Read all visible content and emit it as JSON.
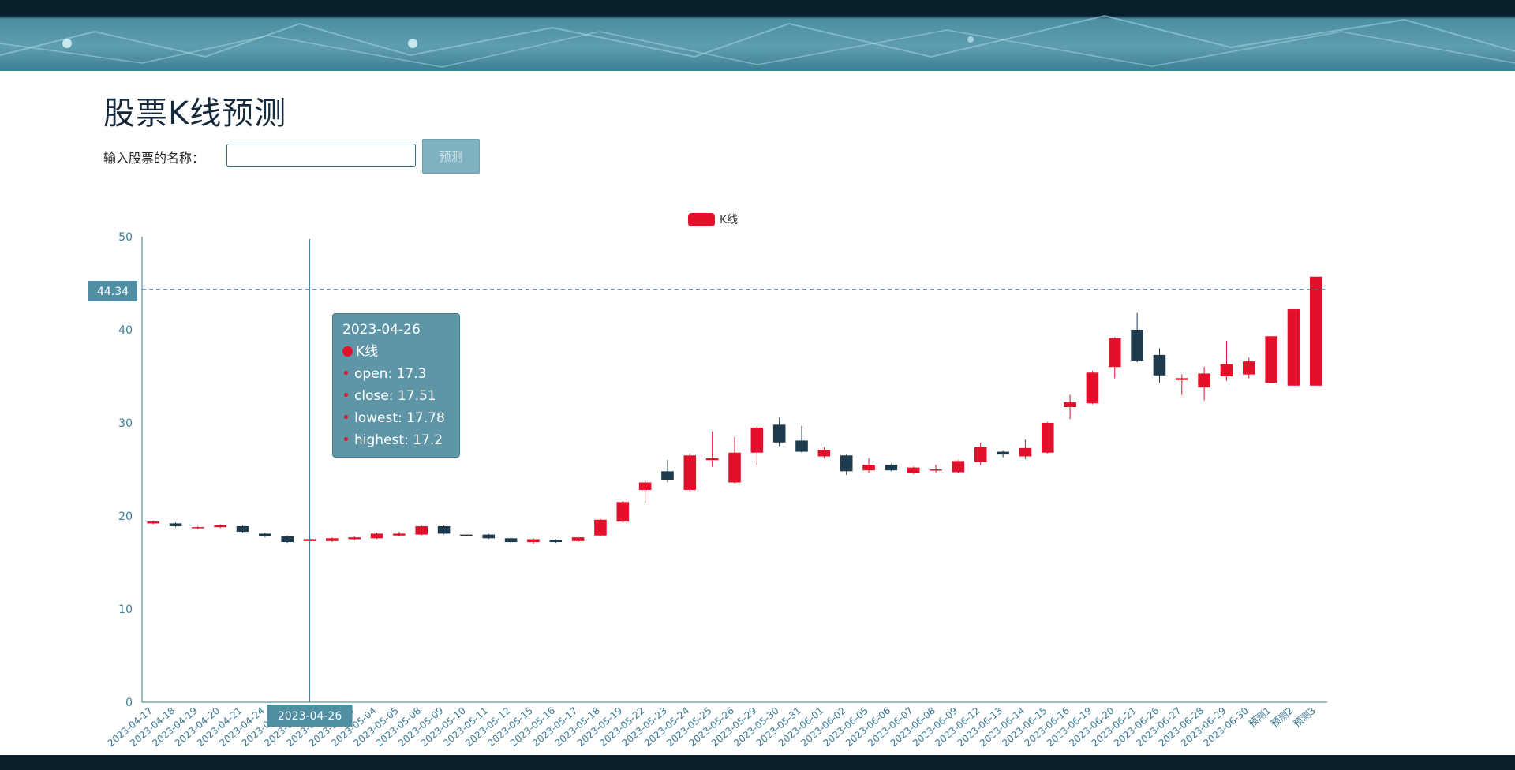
{
  "page": {
    "title": "股票K线预测",
    "search_label": "输入股票的名称：",
    "search_value": "",
    "predict_button": "预测"
  },
  "colors": {
    "up": "#e3102b",
    "down": "#1e3a4c",
    "axis": "#3a7a95",
    "pointer_bg": "#4f8ea3"
  },
  "chart_data": {
    "type": "candlestick",
    "title": "",
    "legend": [
      "K线"
    ],
    "legend_position": "top-center",
    "ylim": [
      0,
      50
    ],
    "y_ticks": [
      0,
      10,
      20,
      30,
      40,
      50
    ],
    "grid": false,
    "crosshair": {
      "x_label": "2023-04-26",
      "y_label": "44.34",
      "y_value": 44.34
    },
    "tooltip": {
      "date": "2023-04-26",
      "series": "K线",
      "rows": [
        {
          "label": "open",
          "value": "17.3"
        },
        {
          "label": "close",
          "value": "17.51"
        },
        {
          "label": "lowest",
          "value": "17.78"
        },
        {
          "label": "highest",
          "value": "17.2"
        }
      ]
    },
    "categories": [
      "2023-04-17",
      "2023-04-18",
      "2023-04-19",
      "2023-04-20",
      "2023-04-21",
      "2023-04-24",
      "2023-04-25",
      "2023-04-26",
      "2023-04-27",
      "2023-04-28",
      "2023-05-04",
      "2023-05-05",
      "2023-05-08",
      "2023-05-09",
      "2023-05-10",
      "2023-05-11",
      "2023-05-12",
      "2023-05-15",
      "2023-05-16",
      "2023-05-17",
      "2023-05-18",
      "2023-05-19",
      "2023-05-22",
      "2023-05-23",
      "2023-05-24",
      "2023-05-25",
      "2023-05-26",
      "2023-05-29",
      "2023-05-30",
      "2023-05-31",
      "2023-06-01",
      "2023-06-02",
      "2023-06-05",
      "2023-06-06",
      "2023-06-07",
      "2023-06-08",
      "2023-06-09",
      "2023-06-12",
      "2023-06-13",
      "2023-06-14",
      "2023-06-15",
      "2023-06-16",
      "2023-06-19",
      "2023-06-20",
      "2023-06-21",
      "2023-06-26",
      "2023-06-27",
      "2023-06-28",
      "2023-06-29",
      "2023-06-30",
      "预测1",
      "预测2",
      "预测3"
    ],
    "ohlc": [
      [
        19.2,
        19.4,
        19.1,
        19.5
      ],
      [
        19.2,
        18.9,
        18.8,
        19.3
      ],
      [
        18.7,
        18.8,
        18.6,
        18.9
      ],
      [
        18.8,
        19.0,
        18.7,
        19.1
      ],
      [
        18.9,
        18.3,
        18.2,
        19.0
      ],
      [
        18.1,
        17.8,
        17.7,
        18.2
      ],
      [
        17.8,
        17.2,
        17.1,
        17.9
      ],
      [
        17.3,
        17.51,
        17.2,
        17.78
      ],
      [
        17.3,
        17.6,
        17.2,
        17.7
      ],
      [
        17.5,
        17.7,
        17.4,
        17.8
      ],
      [
        17.6,
        18.1,
        17.5,
        18.2
      ],
      [
        17.9,
        18.1,
        17.8,
        18.3
      ],
      [
        18.0,
        18.9,
        17.9,
        19.0
      ],
      [
        18.9,
        18.1,
        18.0,
        19.0
      ],
      [
        18.0,
        17.9,
        17.8,
        18.0
      ],
      [
        18.0,
        17.6,
        17.5,
        18.1
      ],
      [
        17.6,
        17.2,
        17.1,
        17.7
      ],
      [
        17.2,
        17.5,
        17.0,
        17.6
      ],
      [
        17.4,
        17.2,
        17.1,
        17.5
      ],
      [
        17.3,
        17.7,
        17.2,
        17.8
      ],
      [
        17.9,
        19.6,
        17.8,
        19.7
      ],
      [
        19.4,
        21.5,
        19.3,
        21.6
      ],
      [
        22.8,
        23.6,
        21.4,
        23.8
      ],
      [
        24.8,
        23.9,
        23.6,
        26.0
      ],
      [
        22.8,
        26.5,
        22.6,
        26.7
      ],
      [
        26.0,
        26.2,
        25.3,
        29.1
      ],
      [
        23.6,
        26.8,
        23.5,
        28.5
      ],
      [
        26.8,
        29.5,
        25.5,
        29.6
      ],
      [
        29.8,
        27.9,
        27.5,
        30.6
      ],
      [
        28.1,
        26.9,
        26.8,
        29.7
      ],
      [
        26.4,
        27.1,
        26.2,
        27.4
      ],
      [
        26.5,
        24.8,
        24.4,
        26.6
      ],
      [
        24.9,
        25.5,
        24.6,
        26.2
      ],
      [
        25.5,
        24.9,
        24.8,
        25.6
      ],
      [
        24.6,
        25.2,
        24.5,
        25.3
      ],
      [
        24.9,
        25.0,
        24.7,
        25.5
      ],
      [
        24.7,
        25.9,
        24.6,
        26.0
      ],
      [
        25.8,
        27.4,
        25.5,
        27.9
      ],
      [
        26.9,
        26.6,
        26.3,
        27.0
      ],
      [
        26.4,
        27.3,
        26.1,
        28.2
      ],
      [
        26.8,
        30.0,
        26.7,
        30.1
      ],
      [
        31.7,
        32.2,
        30.4,
        33.0
      ],
      [
        32.1,
        35.4,
        32.0,
        35.6
      ],
      [
        36.0,
        39.1,
        34.8,
        39.2
      ],
      [
        40.0,
        36.7,
        36.5,
        41.8
      ],
      [
        37.3,
        35.1,
        34.3,
        38.0
      ],
      [
        34.6,
        34.8,
        33.0,
        35.2
      ],
      [
        33.8,
        35.3,
        32.4,
        36.0
      ],
      [
        35.0,
        36.3,
        34.5,
        38.8
      ],
      [
        35.2,
        36.6,
        34.8,
        37.0
      ],
      [
        34.3,
        39.3,
        34.3,
        39.3
      ],
      [
        34.0,
        42.2,
        34.0,
        42.2
      ],
      [
        34.0,
        45.7,
        34.0,
        45.7
      ]
    ]
  }
}
